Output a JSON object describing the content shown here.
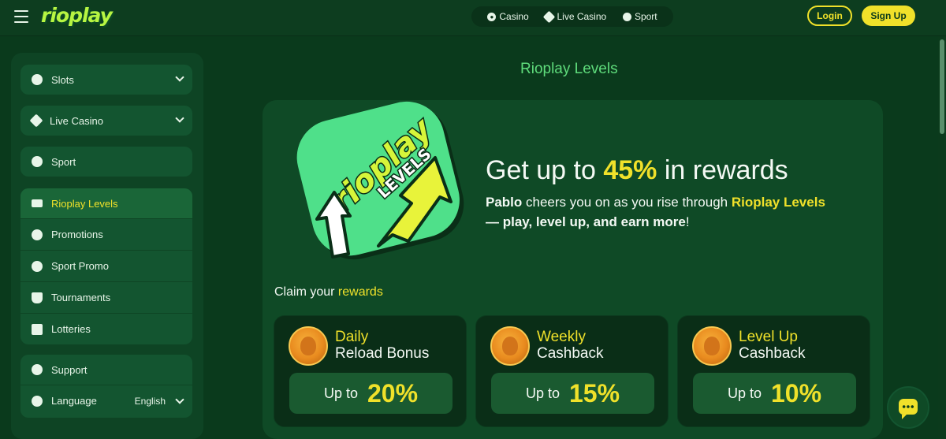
{
  "header": {
    "logo_text": "rioplay",
    "nav": [
      {
        "label": "Casino",
        "icon": "casino-chip-icon"
      },
      {
        "label": "Live Casino",
        "icon": "cards-icon"
      },
      {
        "label": "Sport",
        "icon": "soccer-ball-icon"
      }
    ],
    "login_label": "Login",
    "signup_label": "Sign Up"
  },
  "sidebar": {
    "items": [
      {
        "label": "Slots",
        "icon": "slots-icon",
        "expandable": true
      },
      {
        "label": "Live Casino",
        "icon": "cards-icon",
        "expandable": true
      },
      {
        "label": "Sport",
        "icon": "basketball-icon"
      },
      {
        "label": "Rioplay Levels",
        "icon": "crown-icon",
        "active": true
      },
      {
        "label": "Promotions",
        "icon": "star-burst-icon"
      },
      {
        "label": "Sport Promo",
        "icon": "soccer-ball-icon"
      },
      {
        "label": "Tournaments",
        "icon": "trophy-icon"
      },
      {
        "label": "Lotteries",
        "icon": "calendar-icon"
      },
      {
        "label": "Support",
        "icon": "headset-icon"
      },
      {
        "label": "Language",
        "icon": "globe-icon",
        "value": "English"
      }
    ]
  },
  "main": {
    "page_title": "Rioplay Levels",
    "badge_top": "rioplay",
    "badge_bottom": "LEVELS",
    "headline_pre": "Get up to ",
    "headline_highlight": "45%",
    "headline_post": " in rewards",
    "sub_name": "Pablo",
    "sub_mid": " cheers you on as you rise through ",
    "sub_brand": "Rioplay Levels",
    "sub_end": "— play, level up, and earn more",
    "sub_excl": "!",
    "claim_pre": "Claim your ",
    "claim_highlight": "rewards",
    "rewards": [
      {
        "title_line1": "Daily",
        "title_line2": "Reload Bonus",
        "upto": "Up to",
        "value": "20%"
      },
      {
        "title_line1": "Weekly",
        "title_line2": "Cashback",
        "upto": "Up to",
        "value": "15%"
      },
      {
        "title_line1": "Level Up",
        "title_line2": "Cashback",
        "upto": "Up to",
        "value": "10%"
      }
    ]
  },
  "colors": {
    "accent_yellow": "#f0e12a",
    "accent_green": "#5fdc7c",
    "background": "#0a3a1c"
  }
}
